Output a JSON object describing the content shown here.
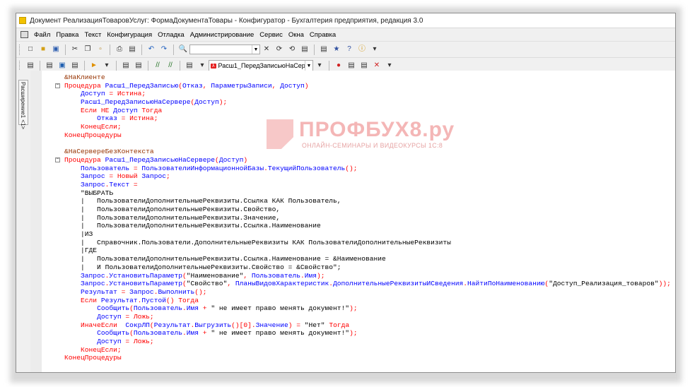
{
  "window": {
    "title": "Документ РеализацияТоваровУслуг: ФормаДокументаТовары - Конфигуратор - Бухгалтерия предприятия, редакция 3.0"
  },
  "menu": [
    "Файл",
    "Правка",
    "Текст",
    "Конфигурация",
    "Отладка",
    "Администрирование",
    "Сервис",
    "Окна",
    "Справка"
  ],
  "toolbar": {
    "search_value": "",
    "procedure_selector": "Расш1_ПередЗаписьюНаСерве"
  },
  "side_panel": {
    "tab_label": "Расширение1 <1>"
  },
  "watermark": {
    "brand": "ПРОФБУХ8.ру",
    "tagline": "ОНЛАЙН-СЕМИНАРЫ И ВИДЕОКУРСЫ 1С:8"
  },
  "code": [
    "&НаКлиенте",
    "Процедура Расш1_ПередЗаписью(Отказ, ПараметрыЗаписи, Доступ)",
    "    Доступ = Истина;",
    "    Расш1_ПередЗаписьюНаСервере(Доступ);",
    "    Если НЕ Доступ Тогда",
    "        Отказ = Истина;",
    "    КонецЕсли;",
    "КонецПроцедуры",
    "",
    "&НаСервереБезКонтекста",
    "Процедура Расш1_ПередЗаписьюНаСервере(Доступ)",
    "    Пользователь = ПользователиИнформационнойБазы.ТекущийПользователь();",
    "    Запрос = Новый Запрос;",
    "    Запрос.Текст =",
    "    \"ВЫБРАТЬ",
    "    |   ПользователиДополнительныеРеквизиты.Ссылка КАК Пользователь,",
    "    |   ПользователиДополнительныеРеквизиты.Свойство,",
    "    |   ПользователиДополнительныеРеквизиты.Значение,",
    "    |   ПользователиДополнительныеРеквизиты.Ссылка.Наименование",
    "    |ИЗ",
    "    |   Справочник.Пользователи.ДополнительныеРеквизиты КАК ПользователиДополнительныеРеквизиты",
    "    |ГДЕ",
    "    |   ПользователиДополнительныеРеквизиты.Ссылка.Наименование = &Наименование",
    "    |   И ПользователиДополнительныеРеквизиты.Свойство = &Свойство\";",
    "    Запрос.УстановитьПараметр(\"Наименование\", Пользователь.Имя);",
    "    Запрос.УстановитьПараметр(\"Свойство\", ПланыВидовХарактеристик.ДополнительныеРеквизитыИСведения.НайтиПоНаименованию(\"Доступ_Реализация_товаров\"));",
    "    Результат = Запрос.Выполнить();",
    "    Если Результат.Пустой() Тогда",
    "        Сообщить(Пользователь.Имя + \" не имеет право менять документ!\");",
    "        Доступ = Ложь;",
    "    ИначеЕсли  СокрЛП(Результат.Выгрузить()[0].Значение) = \"Нет\" Тогда",
    "        Сообщить(Пользователь.Имя + \" не имеет право менять документ!\");",
    "        Доступ = Ложь;",
    "    КонецЕсли;",
    "КонецПроцедуры"
  ]
}
